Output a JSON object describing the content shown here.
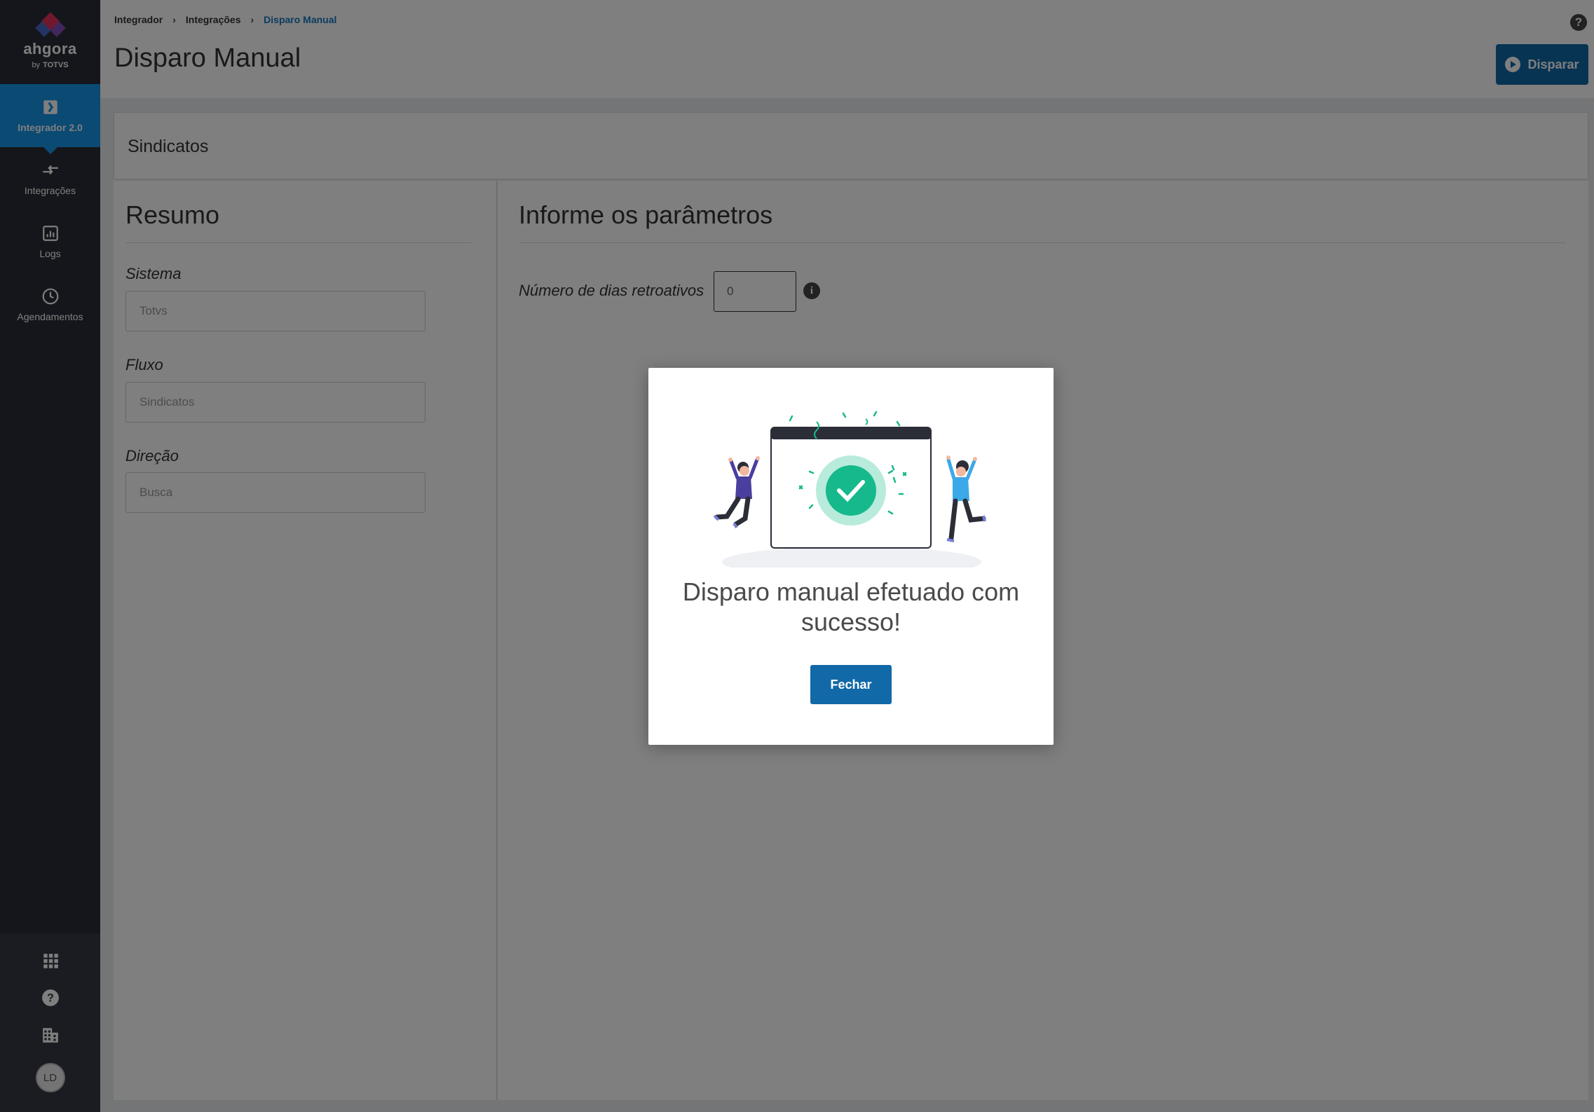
{
  "brand": {
    "name": "ahgora",
    "by": "by",
    "company": "TOTVS"
  },
  "sidebar": {
    "items": [
      {
        "label": "Integrador 2.0",
        "icon": "integrador-icon",
        "active": true
      },
      {
        "label": "Integrações",
        "icon": "arrows-icon"
      },
      {
        "label": "Logs",
        "icon": "chart-icon"
      },
      {
        "label": "Agendamentos",
        "icon": "clock-icon"
      }
    ],
    "bottom": {
      "avatar": "LD"
    }
  },
  "breadcrumb": [
    "Integrador",
    "Integrações",
    "Disparo Manual"
  ],
  "header": {
    "title": "Disparo Manual",
    "action_label": "Disparar"
  },
  "card": {
    "title": "Sindicatos"
  },
  "resumo": {
    "title": "Resumo",
    "fields": [
      {
        "label": "Sistema",
        "value": "Totvs"
      },
      {
        "label": "Fluxo",
        "value": "Sindicatos"
      },
      {
        "label": "Direção",
        "value": "Busca"
      }
    ]
  },
  "parametros": {
    "title": "Informe os parâmetros",
    "dias_label": "Número de dias retroativos",
    "dias_placeholder": "0"
  },
  "modal": {
    "message": "Disparo manual efetuado com sucesso!",
    "button": "Fechar"
  },
  "colors": {
    "primary": "#1169a8",
    "sidebar": "#2b2d37",
    "active": "#1794e6",
    "success": "#16b98c"
  }
}
